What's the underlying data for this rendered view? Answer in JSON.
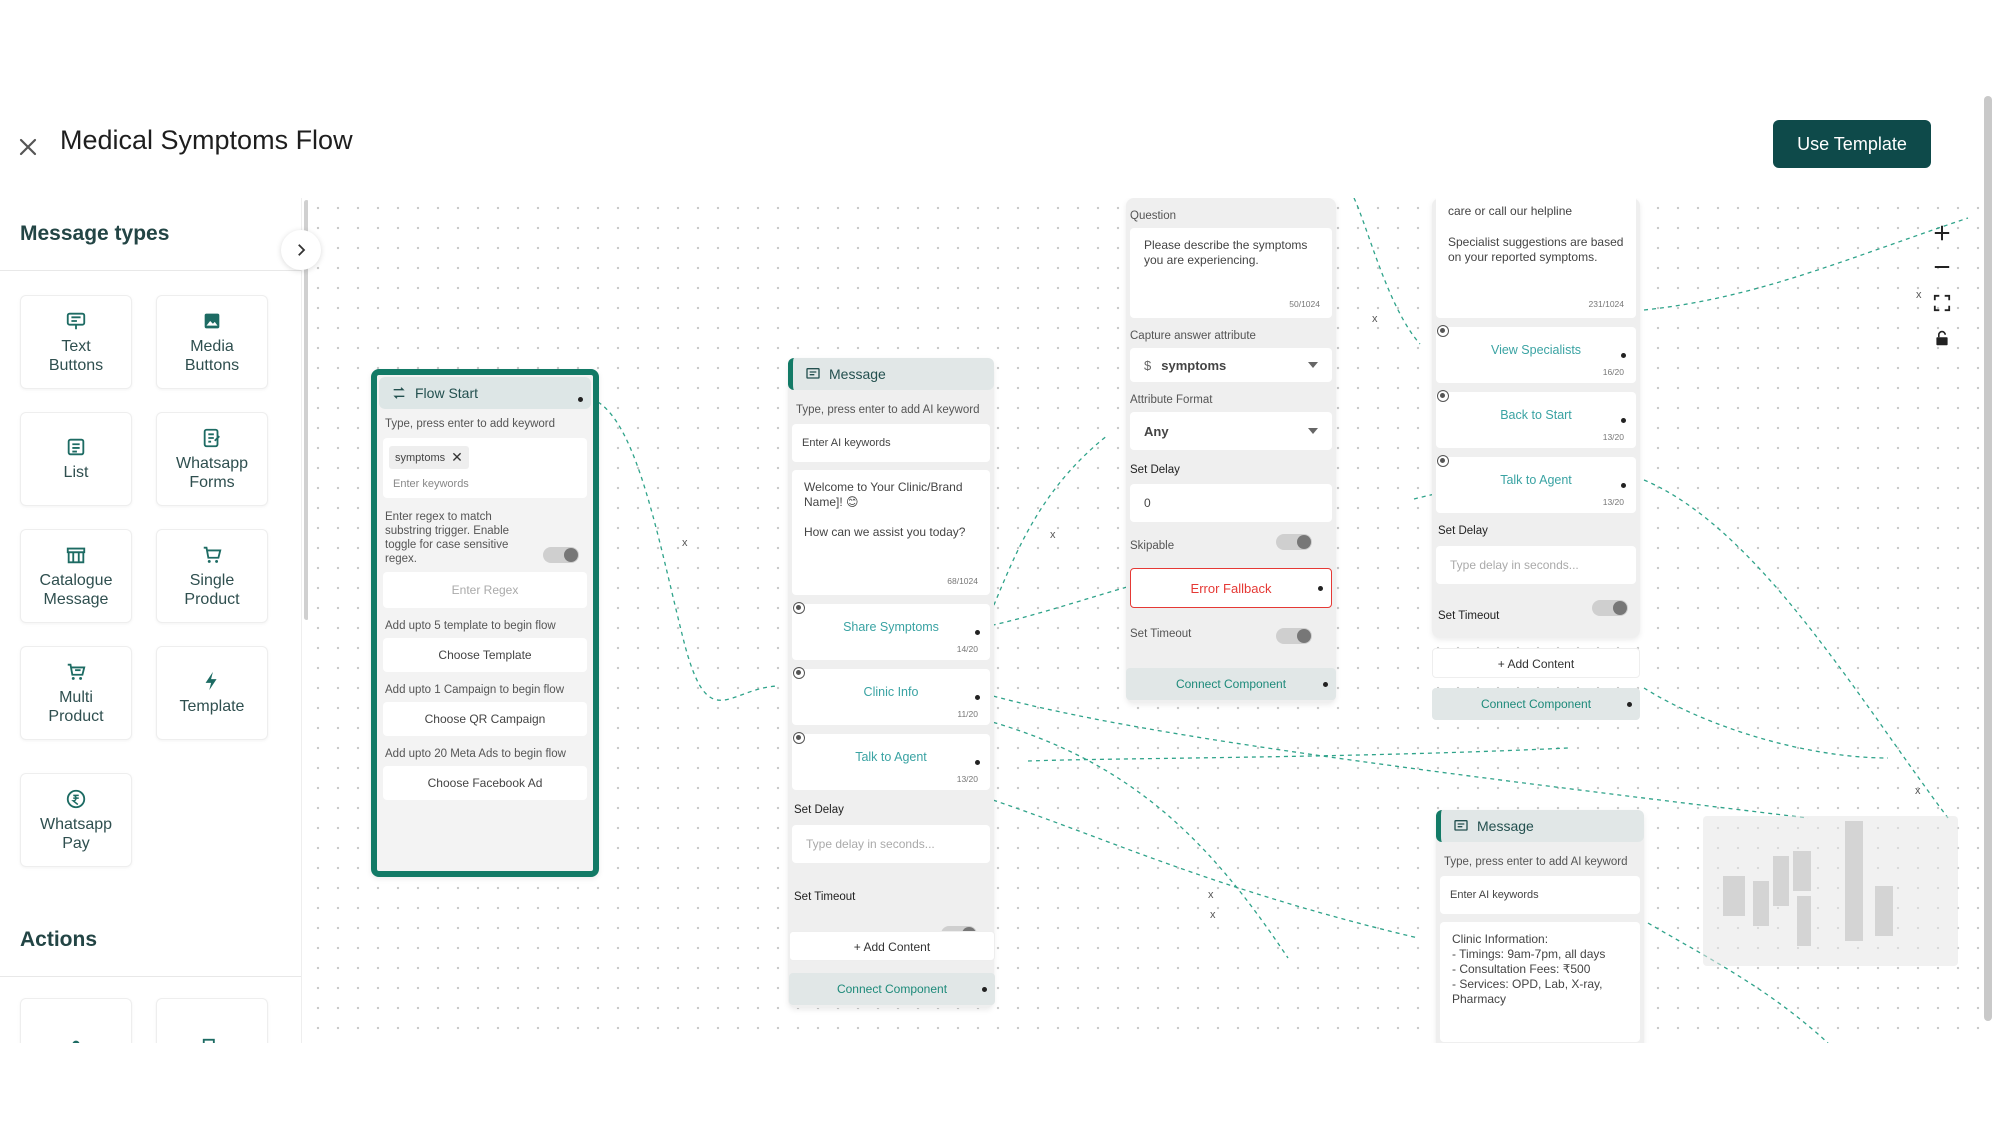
{
  "header": {
    "title": "Medical Symptoms Flow",
    "use_template": "Use Template"
  },
  "sidebar": {
    "message_types_title": "Message types",
    "actions_title": "Actions",
    "tiles": [
      {
        "label": "Text\nButtons",
        "icon": "text-buttons-icon"
      },
      {
        "label": "Media\nButtons",
        "icon": "media-buttons-icon"
      },
      {
        "label": "List",
        "icon": "list-icon"
      },
      {
        "label": "Whatsapp\nForms",
        "icon": "whatsapp-forms-icon"
      },
      {
        "label": "Catalogue\nMessage",
        "icon": "catalogue-icon"
      },
      {
        "label": "Single\nProduct",
        "icon": "cart-icon"
      },
      {
        "label": "Multi\nProduct",
        "icon": "multi-cart-icon"
      },
      {
        "label": "Template",
        "icon": "lightning-icon"
      },
      {
        "label": "Whatsapp\nPay",
        "icon": "rupee-icon"
      }
    ]
  },
  "flow_start": {
    "title": "Flow Start",
    "keyword_hint": "Type, press enter to add keyword",
    "keyword_chip": "symptoms",
    "keyword_placeholder": "Enter keywords",
    "regex_hint": "Enter regex to match substring trigger. Enable toggle for case sensitive regex.",
    "regex_placeholder": "Enter Regex",
    "template_hint": "Add upto 5 template to begin flow",
    "template_btn": "Choose Template",
    "campaign_hint": "Add upto 1 Campaign to begin flow",
    "campaign_btn": "Choose QR Campaign",
    "ads_hint": "Add upto 20 Meta Ads to begin flow",
    "ads_btn": "Choose Facebook Ad"
  },
  "message1": {
    "title": "Message",
    "ai_hint": "Type, press enter to add AI keyword",
    "ai_placeholder": "Enter AI keywords",
    "text_line1": "Welcome to Your Clinic/Brand Name]! 😊",
    "text_line2": "How can we assist you today?",
    "text_count": "68/1024",
    "buttons": [
      {
        "label": "Share Symptoms",
        "count": "14/20"
      },
      {
        "label": "Clinic Info",
        "count": "11/20"
      },
      {
        "label": "Talk to Agent",
        "count": "13/20"
      }
    ],
    "set_delay": "Set Delay",
    "delay_placeholder": "Type delay in seconds...",
    "set_timeout": "Set Timeout",
    "add_content": "+ Add Content",
    "connect": "Connect Component"
  },
  "question": {
    "question_label": "Question",
    "question_text": "Please describe the symptoms you are experiencing.",
    "question_count": "50/1024",
    "capture_label": "Capture answer attribute",
    "capture_symbol": "$",
    "capture_value": "symptoms",
    "format_label": "Attribute Format",
    "format_value": "Any",
    "set_delay": "Set Delay",
    "delay_value": "0",
    "skipable": "Skipable",
    "error_fallback": "Error Fallback",
    "set_timeout": "Set Timeout",
    "connect": "Connect Component"
  },
  "specialist": {
    "text_line1": "care or call our helpline",
    "text_line2": "Specialist suggestions are based on your reported symptoms.",
    "text_count": "231/1024",
    "buttons": [
      {
        "label": "View Specialists",
        "count": "16/20"
      },
      {
        "label": "Back to Start",
        "count": "13/20"
      },
      {
        "label": "Talk to Agent",
        "count": "13/20"
      }
    ],
    "set_delay": "Set Delay",
    "delay_placeholder": "Type delay in seconds...",
    "set_timeout": "Set Timeout",
    "add_content": "+ Add Content",
    "connect": "Connect Component"
  },
  "message2": {
    "title": "Message",
    "ai_hint": "Type, press enter to add AI keyword",
    "ai_placeholder": "Enter AI keywords",
    "info_lines": [
      "Clinic Information:",
      "- Timings: 9am-7pm, all days",
      "- Consultation Fees: ₹500",
      "- Services: OPD, Lab, X-ray, Pharmacy"
    ]
  },
  "colors": {
    "accent": "#0e4a4a",
    "node_border": "#127a66",
    "link": "#3aa3a3",
    "error": "#e53935"
  }
}
